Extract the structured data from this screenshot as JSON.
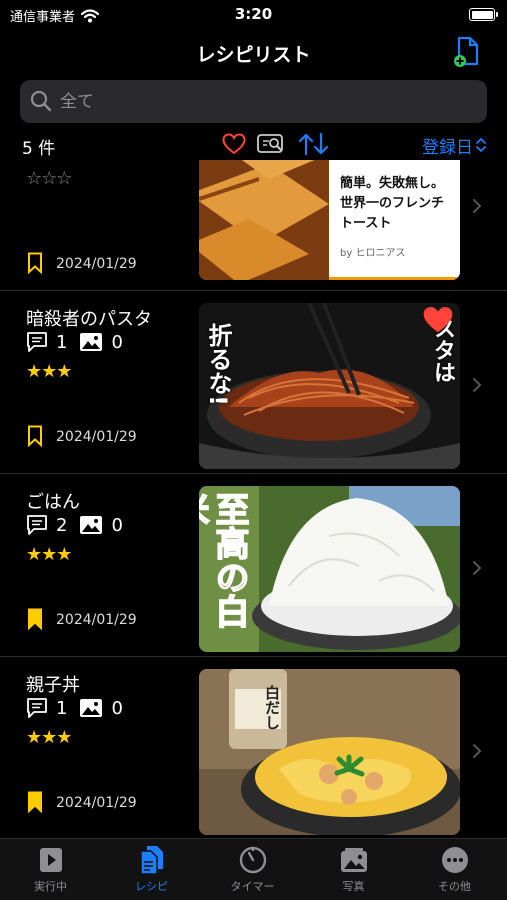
{
  "status_bar": {
    "carrier": "通信事業者",
    "time": "3:20"
  },
  "nav": {
    "title": "レシピリスト"
  },
  "search": {
    "placeholder": "全て"
  },
  "toolbar": {
    "count": "5 件",
    "sort_label": "登録日"
  },
  "recipes": [
    {
      "title": "",
      "stars": "☆☆☆",
      "date": "2024/01/29",
      "thumb_text": [
        "簡単。失敗無し。",
        "世界一のフレンチ",
        "トースト"
      ],
      "thumb_credit": "by ヒロニアス"
    },
    {
      "title": "暗殺者のパスタ",
      "comments": "1",
      "photos": "0",
      "stars": "★★★",
      "date": "2024/01/29",
      "thumb_text_left": "折るな!",
      "thumb_text_right": "スタは"
    },
    {
      "title": "ごはん",
      "comments": "2",
      "photos": "0",
      "stars": "★★★",
      "date": "2024/01/29",
      "thumb_text": "至高の白米"
    },
    {
      "title": "親子丼",
      "comments": "1",
      "photos": "0",
      "stars": "★★★",
      "date": "2024/01/29",
      "thumb_text": "白だし"
    }
  ],
  "tabs": [
    {
      "label": "実行中",
      "icon": "play-icon"
    },
    {
      "label": "レシピ",
      "icon": "document-icon"
    },
    {
      "label": "タイマー",
      "icon": "timer-icon"
    },
    {
      "label": "写真",
      "icon": "photo-icon"
    },
    {
      "label": "その他",
      "icon": "more-icon"
    }
  ],
  "colors": {
    "accent": "#1f7dff",
    "star": "#ffcc00",
    "heart": "#ff453a",
    "background": "#000000"
  }
}
